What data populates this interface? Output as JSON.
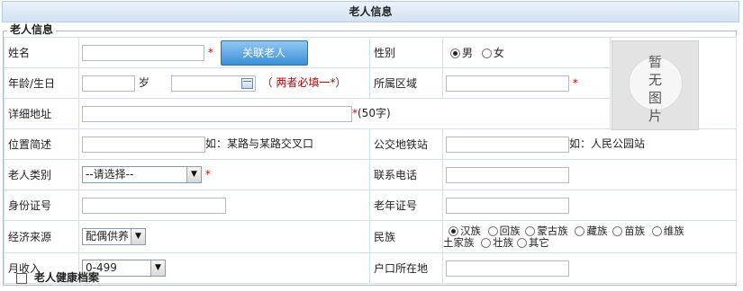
{
  "header": {
    "title": "老人信息"
  },
  "section": {
    "legend": "老人信息"
  },
  "actions": {
    "associate_label": "关联老人"
  },
  "required_mark": "*",
  "photo": {
    "placeholder": "暂无图片"
  },
  "fields": {
    "name": {
      "label": "姓名",
      "value": ""
    },
    "gender": {
      "label": "性别",
      "options": [
        "男",
        "女"
      ],
      "selected": "男"
    },
    "age_birth": {
      "label": "年龄/生日",
      "age_value": "",
      "age_unit": "岁",
      "birthday_value": "",
      "note": "（ 两者必填一*）"
    },
    "district": {
      "label": "所属区域",
      "value": ""
    },
    "address": {
      "label": "详细地址",
      "value": "",
      "limit_note": "(50字)"
    },
    "location": {
      "label": "位置简述",
      "value": "",
      "hint": "如：某路与某路交叉口"
    },
    "transit": {
      "label": "公交地铁站",
      "value": "",
      "hint": "如：人民公园站"
    },
    "category": {
      "label": "老人类别",
      "selected": "--请选择--"
    },
    "phone": {
      "label": "联系电话",
      "value": ""
    },
    "id_number": {
      "label": "身份证号",
      "value": ""
    },
    "senior_card": {
      "label": "老年证号",
      "value": ""
    },
    "income_source": {
      "label": "经济来源",
      "selected": "配偶供养"
    },
    "ethnicity": {
      "label": "民族",
      "options": [
        "汉族",
        "回族",
        "蒙古族",
        "藏族",
        "苗族",
        "维族",
        "土家族",
        "壮族",
        "其它"
      ],
      "selected": "汉族"
    },
    "monthly_income": {
      "label": "月收入",
      "selected": "0-499"
    },
    "household": {
      "label": "户口所在地",
      "value": ""
    }
  },
  "health_record": {
    "label": "老人健康档案",
    "checked": false
  }
}
